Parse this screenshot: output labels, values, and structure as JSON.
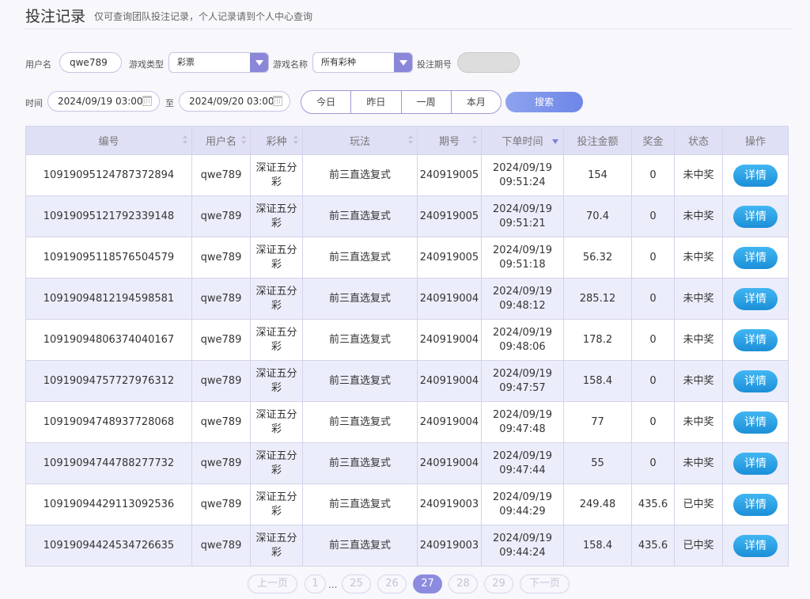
{
  "header": {
    "title": "投注记录",
    "subtitle": "仅可查询团队投注记录，个人记录请到个人中心查询"
  },
  "filters": {
    "username_label": "用户名",
    "username_value": "qwe789",
    "game_type_label": "游戏类型",
    "game_type_value": "彩票",
    "game_name_label": "游戏名称",
    "game_name_value": "所有彩种",
    "issue_label": "投注期号",
    "issue_value": "",
    "time_label": "时间",
    "time_from": "2024/09/19 03:00",
    "to_label": "至",
    "time_to": "2024/09/20 03:00",
    "quick_ranges": [
      "今日",
      "昨日",
      "一周",
      "本月"
    ],
    "search_label": "搜索"
  },
  "table": {
    "columns": [
      "编号",
      "用户名",
      "彩种",
      "玩法",
      "期号",
      "下单时间",
      "投注金额",
      "奖金",
      "状态",
      "操作"
    ],
    "detail_label": "详情",
    "rows": [
      {
        "id": "10919095124787372894",
        "user": "qwe789",
        "lottery": "深证五分彩",
        "play": "前三直选复式",
        "issue": "240919005",
        "date": "2024/09/19",
        "time": "09:51:24",
        "amount": "154",
        "prize": "0",
        "status": "未中奖"
      },
      {
        "id": "10919095121792339148",
        "user": "qwe789",
        "lottery": "深证五分彩",
        "play": "前三直选复式",
        "issue": "240919005",
        "date": "2024/09/19",
        "time": "09:51:21",
        "amount": "70.4",
        "prize": "0",
        "status": "未中奖"
      },
      {
        "id": "10919095118576504579",
        "user": "qwe789",
        "lottery": "深证五分彩",
        "play": "前三直选复式",
        "issue": "240919005",
        "date": "2024/09/19",
        "time": "09:51:18",
        "amount": "56.32",
        "prize": "0",
        "status": "未中奖"
      },
      {
        "id": "10919094812194598581",
        "user": "qwe789",
        "lottery": "深证五分彩",
        "play": "前三直选复式",
        "issue": "240919004",
        "date": "2024/09/19",
        "time": "09:48:12",
        "amount": "285.12",
        "prize": "0",
        "status": "未中奖"
      },
      {
        "id": "10919094806374040167",
        "user": "qwe789",
        "lottery": "深证五分彩",
        "play": "前三直选复式",
        "issue": "240919004",
        "date": "2024/09/19",
        "time": "09:48:06",
        "amount": "178.2",
        "prize": "0",
        "status": "未中奖"
      },
      {
        "id": "10919094757727976312",
        "user": "qwe789",
        "lottery": "深证五分彩",
        "play": "前三直选复式",
        "issue": "240919004",
        "date": "2024/09/19",
        "time": "09:47:57",
        "amount": "158.4",
        "prize": "0",
        "status": "未中奖"
      },
      {
        "id": "10919094748937728068",
        "user": "qwe789",
        "lottery": "深证五分彩",
        "play": "前三直选复式",
        "issue": "240919004",
        "date": "2024/09/19",
        "time": "09:47:48",
        "amount": "77",
        "prize": "0",
        "status": "未中奖"
      },
      {
        "id": "10919094744788277732",
        "user": "qwe789",
        "lottery": "深证五分彩",
        "play": "前三直选复式",
        "issue": "240919004",
        "date": "2024/09/19",
        "time": "09:47:44",
        "amount": "55",
        "prize": "0",
        "status": "未中奖"
      },
      {
        "id": "10919094429113092536",
        "user": "qwe789",
        "lottery": "深证五分彩",
        "play": "前三直选复式",
        "issue": "240919003",
        "date": "2024/09/19",
        "time": "09:44:29",
        "amount": "249.48",
        "prize": "435.6",
        "status": "已中奖"
      },
      {
        "id": "10919094424534726635",
        "user": "qwe789",
        "lottery": "深证五分彩",
        "play": "前三直选复式",
        "issue": "240919003",
        "date": "2024/09/19",
        "time": "09:44:24",
        "amount": "158.4",
        "prize": "435.6",
        "status": "已中奖"
      }
    ]
  },
  "pagination": {
    "prev_label": "上一页",
    "first": "1",
    "ellipsis": "...",
    "pages": [
      "25",
      "26",
      "27",
      "28",
      "29"
    ],
    "current": "27",
    "next_label": "下一页"
  },
  "colors": {
    "accent": "#8b87d8",
    "detail_button": "#2aa0e4",
    "won_status": "#e6413b",
    "current_page": "#8c8be0"
  }
}
